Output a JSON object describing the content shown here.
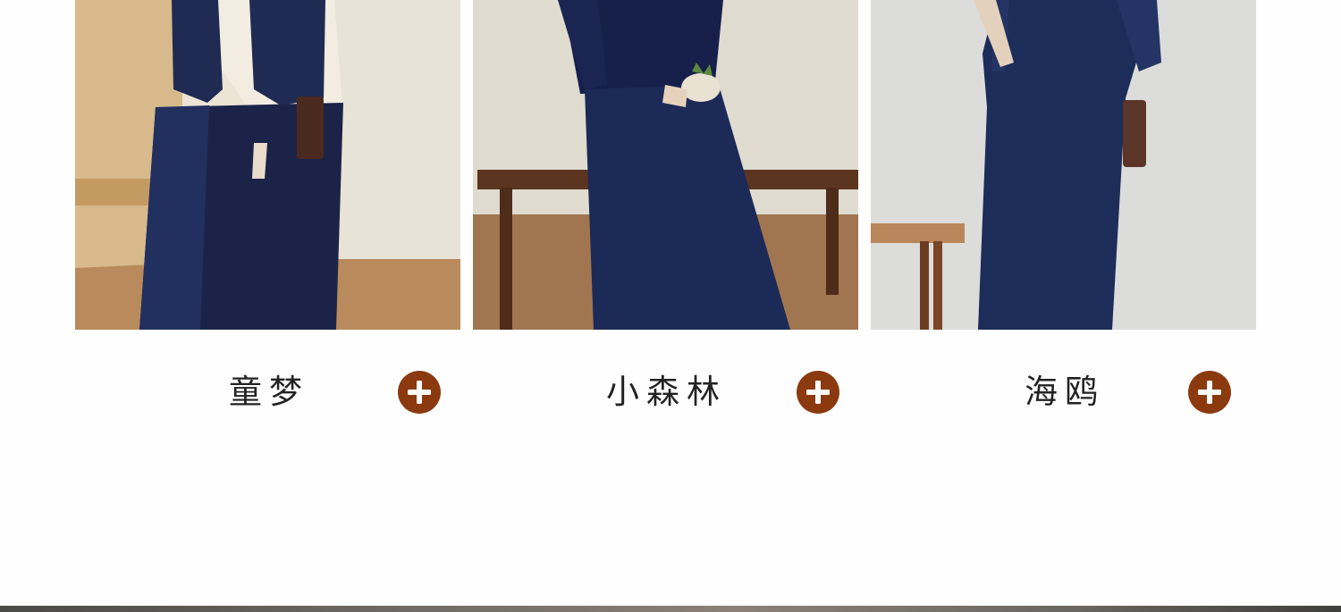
{
  "products": [
    {
      "name": "童梦",
      "add_icon": "plus-icon",
      "accent": "#8b3a10"
    },
    {
      "name": "小森林",
      "add_icon": "plus-icon",
      "accent": "#8b3a10"
    },
    {
      "name": "海鸥",
      "add_icon": "plus-icon",
      "accent": "#8b3a10"
    }
  ]
}
